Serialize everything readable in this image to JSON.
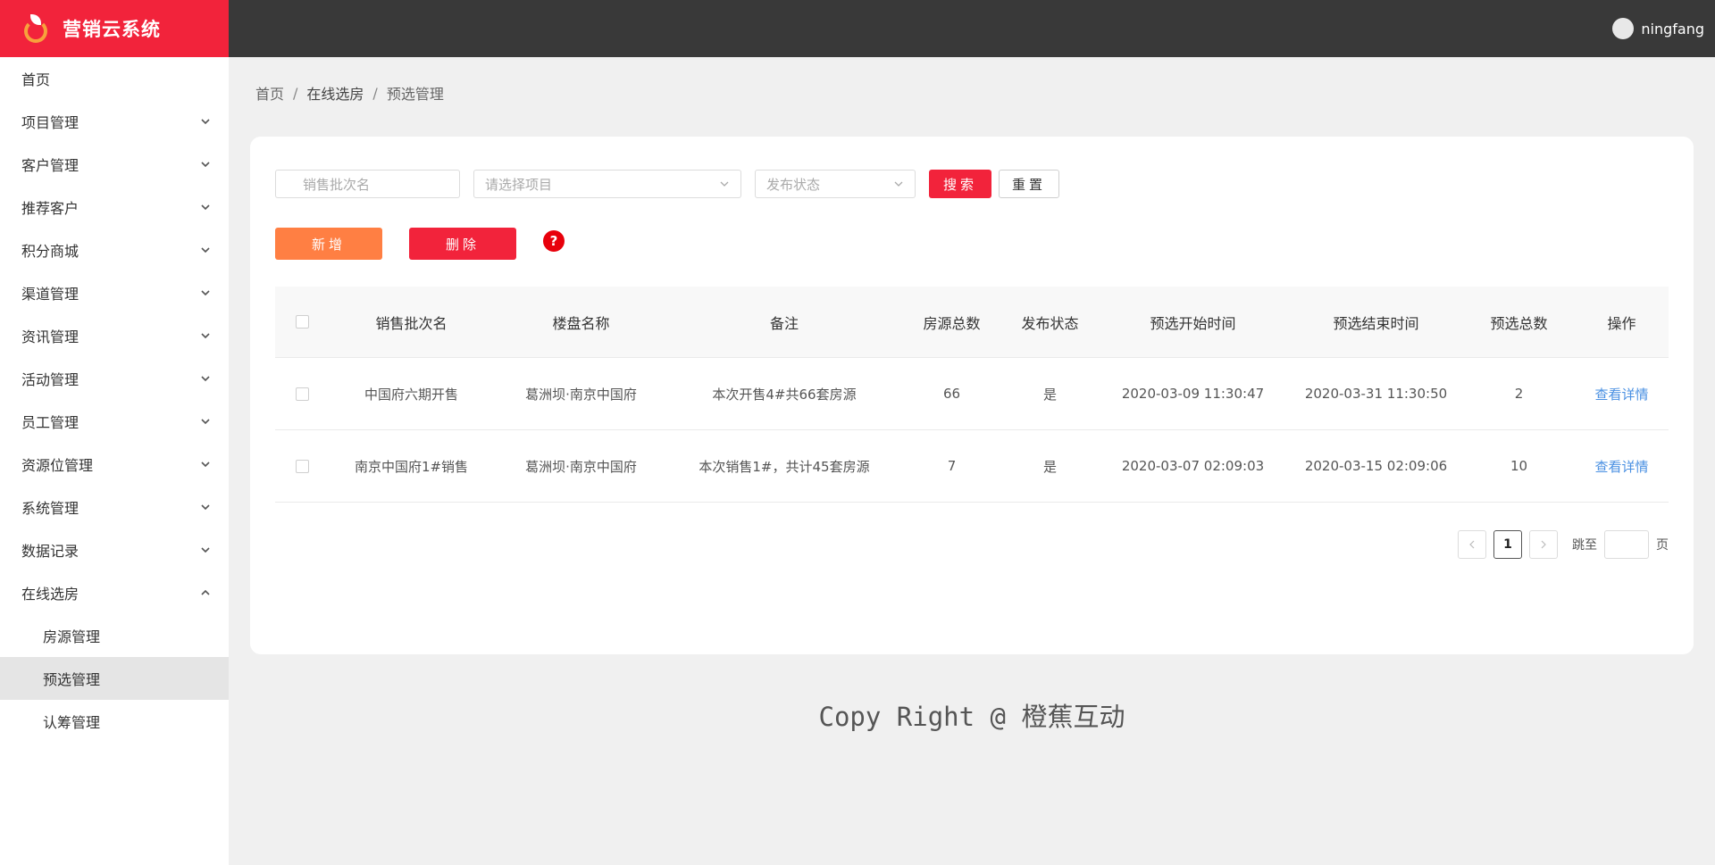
{
  "app": {
    "title": "营销云系统"
  },
  "user": {
    "name": "ningfang"
  },
  "sidebar": {
    "items": [
      {
        "label": "首页",
        "expandable": false
      },
      {
        "label": "项目管理",
        "expandable": true
      },
      {
        "label": "客户管理",
        "expandable": true
      },
      {
        "label": "推荐客户",
        "expandable": true
      },
      {
        "label": "积分商城",
        "expandable": true
      },
      {
        "label": "渠道管理",
        "expandable": true
      },
      {
        "label": "资讯管理",
        "expandable": true
      },
      {
        "label": "活动管理",
        "expandable": true
      },
      {
        "label": "员工管理",
        "expandable": true
      },
      {
        "label": "资源位管理",
        "expandable": true
      },
      {
        "label": "系统管理",
        "expandable": true
      },
      {
        "label": "数据记录",
        "expandable": true
      },
      {
        "label": "在线选房",
        "expandable": true,
        "expanded": true
      }
    ],
    "subitems": [
      {
        "label": "房源管理"
      },
      {
        "label": "预选管理",
        "active": true
      },
      {
        "label": "认筹管理"
      }
    ]
  },
  "breadcrumb": {
    "home": "首页",
    "parent": "在线选房",
    "current": "预选管理",
    "separator": "/"
  },
  "filters": {
    "batch_name_placeholder": "销售批次名",
    "project_placeholder": "请选择项目",
    "status_placeholder": "发布状态",
    "search_label": "搜索",
    "reset_label": "重置"
  },
  "actions": {
    "add_label": "新增",
    "delete_label": "删除",
    "help_label": "?"
  },
  "table": {
    "headers": [
      "销售批次名",
      "楼盘名称",
      "备注",
      "房源总数",
      "发布状态",
      "预选开始时间",
      "预选结束时间",
      "预选总数",
      "操作"
    ],
    "rows": [
      {
        "batch": "中国府六期开售",
        "estate": "葛洲坝·南京中国府",
        "remark": "本次开售4#共66套房源",
        "total": "66",
        "published": "是",
        "start": "2020-03-09 11:30:47",
        "end": "2020-03-31 11:30:50",
        "preselect": "2",
        "action": "查看详情"
      },
      {
        "batch": "南京中国府1#销售",
        "estate": "葛洲坝·南京中国府",
        "remark": "本次销售1#，共计45套房源",
        "total": "7",
        "published": "是",
        "start": "2020-03-07 02:09:03",
        "end": "2020-03-15 02:09:06",
        "preselect": "10",
        "action": "查看详情"
      }
    ]
  },
  "pagination": {
    "current_page": "1",
    "jump_label": "跳至",
    "page_unit": "页"
  },
  "footer": {
    "text": "Copy Right @ 橙蕉互动"
  },
  "colors": {
    "brand": "#f2233b",
    "header_bg": "#393939",
    "accent_orange": "#ff7f43",
    "link": "#4a90e2"
  }
}
